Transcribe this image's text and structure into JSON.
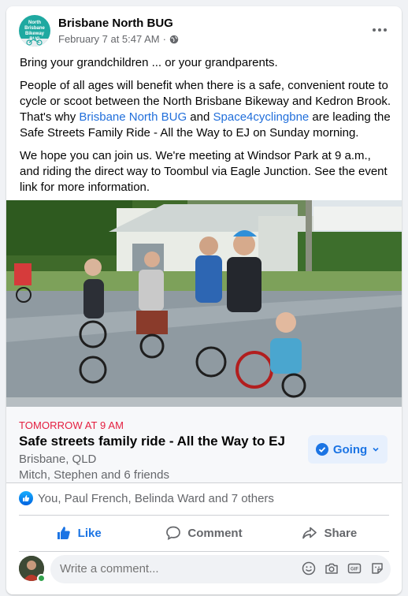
{
  "post": {
    "page_name": "Brisbane North BUG",
    "timestamp": "February 7 at 5:47 AM",
    "audience_icon": "globe-icon",
    "avatar_text": "North Brisbane Bikeway BUG",
    "paragraphs": {
      "p1": "Bring your grandchildren ... or your grandparents.",
      "p2_a": "People of all ages will benefit when there is a safe, convenient route to cycle or scoot between the North Brisbane Bikeway and Kedron Brook. That's why ",
      "p2_link1": "Brisbane North BUG",
      "p2_b": " and ",
      "p2_link2": "Space4cyclingbne",
      "p2_c": " are leading the Safe Streets Family Ride - All the Way to EJ on Sunday morning.",
      "p3": "We hope you can join us. We're meeting at Windsor Park at 9 a.m., and riding the direct way to Toombul via Eagle Junction. See the event link for more information."
    }
  },
  "event": {
    "when": "TOMORROW AT 9 AM",
    "title": "Safe streets family ride - All the Way to EJ",
    "location": "Brisbane, QLD",
    "friends": "Mitch, Stephen and 6 friends",
    "going_label": "Going"
  },
  "reactions": {
    "text": "You, Paul French, Belinda Ward and 7 others"
  },
  "actions": {
    "like": "Like",
    "comment": "Comment",
    "share": "Share"
  },
  "comment_box": {
    "placeholder": "Write a comment..."
  },
  "colors": {
    "accent_blue": "#1b74e4",
    "event_red": "#e41e3f",
    "muted_text": "#65676b"
  }
}
